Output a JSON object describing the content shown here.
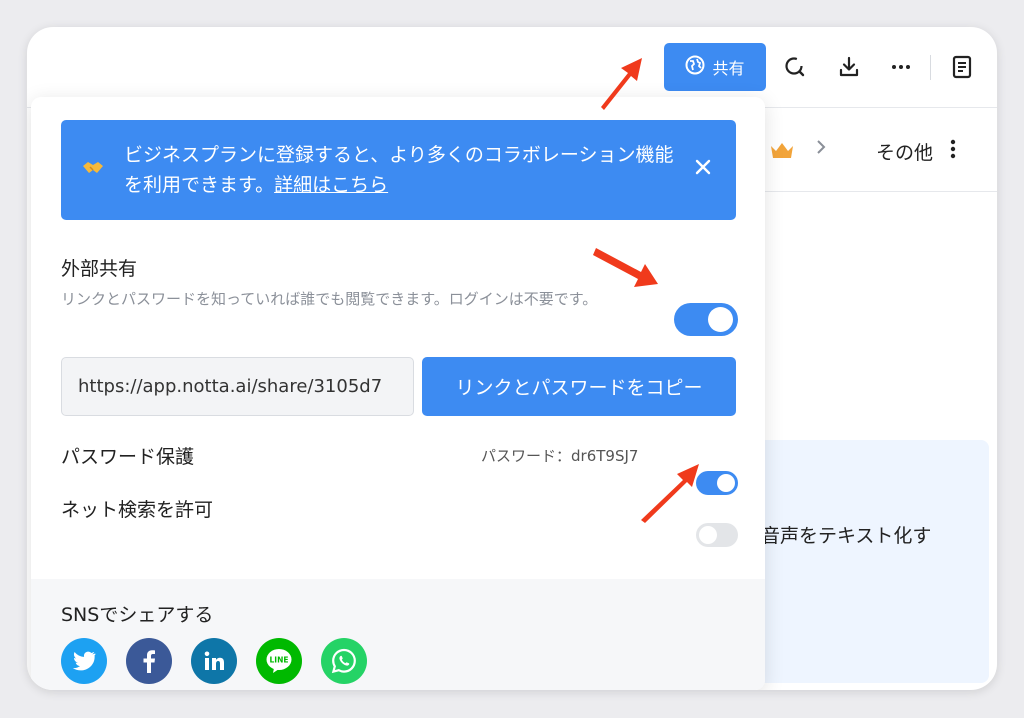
{
  "topbar": {
    "share_label": "共有",
    "icons": [
      "globe-icon",
      "search-refresh-icon",
      "download-icon",
      "more-horizontal-icon",
      "notes-icon"
    ]
  },
  "background": {
    "more_label": "その他",
    "card_text": "音声をテキスト化す"
  },
  "banner": {
    "text": "ビジネスプランに登録すると、より多くのコラボレーション機能を利用できます。",
    "link_label": "詳細はこちら"
  },
  "external_share": {
    "title": "外部共有",
    "description": "リンクとパスワードを知っていれば誰でも閲覧できます。ログインは不要です。",
    "enabled": true
  },
  "link": {
    "url": "https://app.notta.ai/share/3105d7",
    "copy_label": "リンクとパスワードをコピー"
  },
  "password_protection": {
    "label": "パスワード保護",
    "password_text": "パスワード：dr6T9SJ7",
    "enabled": true
  },
  "net_search": {
    "label": "ネット検索を許可",
    "enabled": false
  },
  "sns": {
    "title": "SNSでシェアする",
    "items": [
      {
        "name": "twitter-icon",
        "color": "#1da1f2"
      },
      {
        "name": "facebook-icon",
        "color": "#3b5998"
      },
      {
        "name": "linkedin-icon",
        "color": "#0e76a8"
      },
      {
        "name": "line-icon",
        "color": "#00b900"
      },
      {
        "name": "whatsapp-icon",
        "color": "#25d366"
      }
    ]
  },
  "colors": {
    "accent": "#3d8bf2",
    "arrow": "#f03a1c"
  }
}
